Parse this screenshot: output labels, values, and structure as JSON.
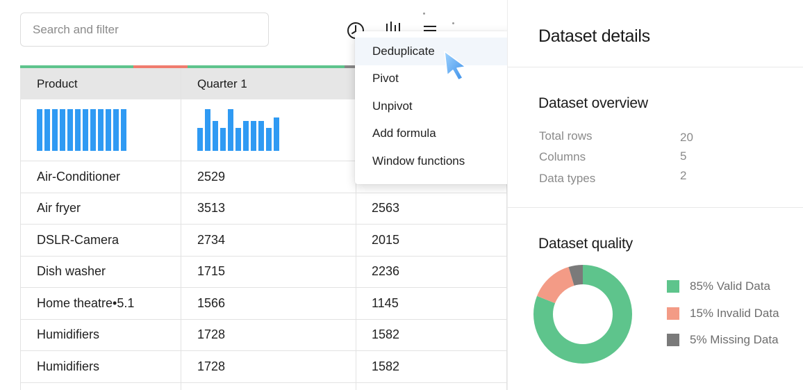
{
  "search": {
    "placeholder": "Search and filter"
  },
  "toolbar": {
    "icons": [
      "clock-icon",
      "bar-chart-icon",
      "menu-icon"
    ]
  },
  "table": {
    "headers": [
      "Product",
      "Quarter 1",
      ""
    ],
    "rows": [
      [
        "Air-Conditioner",
        "2529",
        ""
      ],
      [
        "Air fryer",
        "3513",
        "2563"
      ],
      [
        "DSLR-Camera",
        "2734",
        "2015"
      ],
      [
        "Dish washer",
        "1715",
        "2236"
      ],
      [
        "Home theatre•5.1",
        "1566",
        "1145"
      ],
      [
        "Humidifiers",
        "1728",
        "1582"
      ],
      [
        "Humidifiers",
        "1728",
        "1582"
      ]
    ],
    "spark_q1_levels": [
      0.55,
      1.0,
      0.72,
      0.55,
      1.0,
      0.55,
      0.72,
      0.72,
      0.72,
      0.55,
      0.8
    ],
    "spark_product_levels": [
      1,
      1,
      1,
      1,
      1,
      1,
      1,
      1,
      1,
      1,
      1,
      1
    ],
    "colors": {
      "bar": "#2f9af3",
      "stripe_valid": "#5ec48c",
      "stripe_invalid": "#f07c6e",
      "stripe_missing": "#888888"
    }
  },
  "menu": {
    "items": [
      "Deduplicate",
      "Pivot",
      "Unpivot",
      "Add formula",
      "Window functions"
    ],
    "active_index": 0
  },
  "details": {
    "title": "Dataset details",
    "overview": {
      "title": "Dataset overview",
      "stats": [
        {
          "label": "Total rows",
          "value": "20"
        },
        {
          "label": "Columns",
          "value": "5"
        },
        {
          "label": "Data types",
          "value": "2"
        }
      ]
    },
    "quality": {
      "title": "Dataset quality",
      "segments": [
        {
          "label": "85% Valid Data",
          "value": 85,
          "color": "#5ec48c"
        },
        {
          "label": "15% Invalid Data",
          "value": 15,
          "color": "#f39b86"
        },
        {
          "label": "5% Missing Data",
          "value": 5,
          "color": "#7a7a7a"
        }
      ]
    }
  }
}
